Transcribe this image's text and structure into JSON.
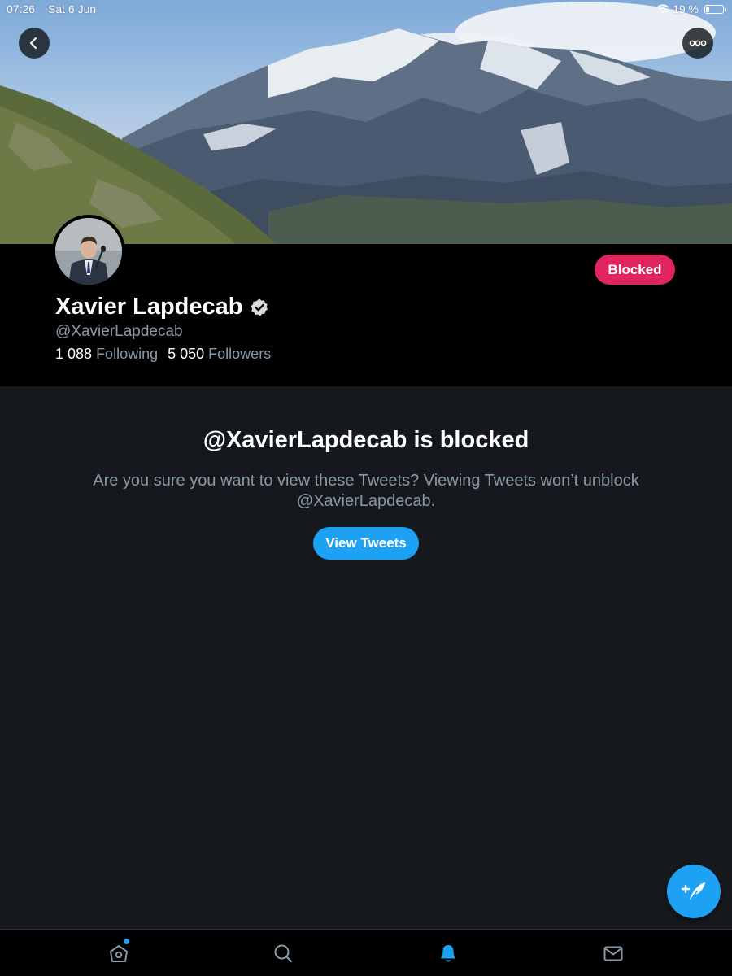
{
  "status_bar": {
    "time": "07:26",
    "date": "Sat 6 Jun",
    "battery": "19 %"
  },
  "profile": {
    "display_name": "Xavier Lapdecab",
    "handle": "@XavierLapdecab",
    "following_count": "1 088",
    "following_label": "Following",
    "followers_count": "5 050",
    "followers_label": "Followers",
    "verified": true
  },
  "actions": {
    "blocked_label": "Blocked"
  },
  "notice": {
    "title": "@XavierLapdecab is blocked",
    "text": "Are you sure you want to view these Tweets? Viewing Tweets won’t unblock @XavierLapdecab.",
    "button_label": "View Tweets"
  },
  "tabs": [
    {
      "icon": "home-icon",
      "active": false,
      "has_dot": true
    },
    {
      "icon": "search-icon",
      "active": false
    },
    {
      "icon": "bell-icon",
      "active": true
    },
    {
      "icon": "mail-icon",
      "active": false
    }
  ],
  "colors": {
    "accent": "#1da1f2",
    "blocked": "#e0245e",
    "background": "#15181c",
    "header_bg": "#000000",
    "muted_text": "#8899a6"
  }
}
